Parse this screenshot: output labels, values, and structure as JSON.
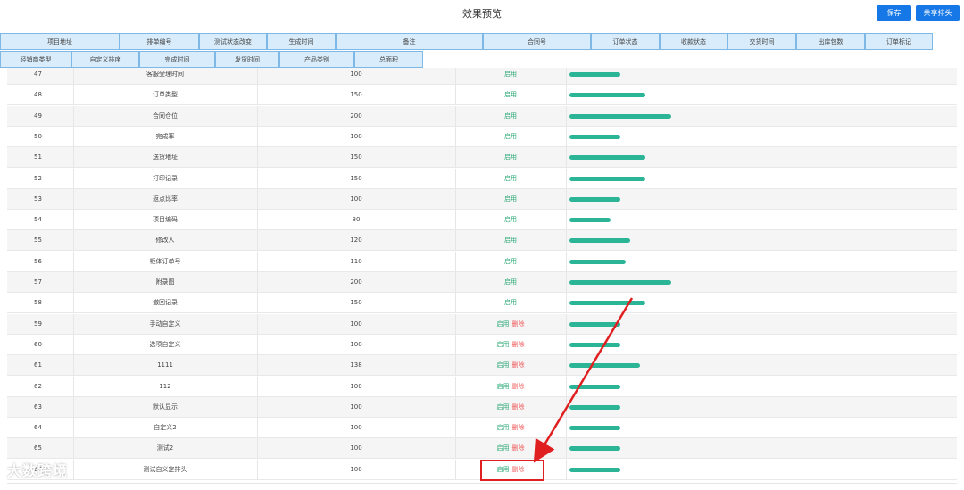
{
  "header": {
    "title": "效果预览",
    "save_label": "保存",
    "share_label": "共享排头"
  },
  "chips_row1": [
    "项目地址",
    "排单编号",
    "测试状态改变",
    "生成时间",
    "备注",
    "合同号",
    "订单状态",
    "收款状态",
    "交货时间",
    "出库包数",
    "订单标记"
  ],
  "chips_row2": [
    "经销商类型",
    "自定义排序",
    "完成时间",
    "发货时间",
    "产品类别",
    "总面积"
  ],
  "actions": {
    "enable": "启用",
    "delete": "删除"
  },
  "rows": [
    {
      "num": "47",
      "name": "客服受理时间",
      "width": "100",
      "deletable": false,
      "bar": 100
    },
    {
      "num": "48",
      "name": "订单类型",
      "width": "150",
      "deletable": false,
      "bar": 150
    },
    {
      "num": "49",
      "name": "合同仓位",
      "width": "200",
      "deletable": false,
      "bar": 200
    },
    {
      "num": "50",
      "name": "完成率",
      "width": "100",
      "deletable": false,
      "bar": 100
    },
    {
      "num": "51",
      "name": "送货地址",
      "width": "150",
      "deletable": false,
      "bar": 150
    },
    {
      "num": "52",
      "name": "打印记录",
      "width": "150",
      "deletable": false,
      "bar": 150
    },
    {
      "num": "53",
      "name": "返点比率",
      "width": "100",
      "deletable": false,
      "bar": 100
    },
    {
      "num": "54",
      "name": "项目编码",
      "width": "80",
      "deletable": false,
      "bar": 80
    },
    {
      "num": "55",
      "name": "修改人",
      "width": "120",
      "deletable": false,
      "bar": 120
    },
    {
      "num": "56",
      "name": "柜体订单号",
      "width": "110",
      "deletable": false,
      "bar": 110
    },
    {
      "num": "57",
      "name": "附录图",
      "width": "200",
      "deletable": false,
      "bar": 200
    },
    {
      "num": "58",
      "name": "撤回记录",
      "width": "150",
      "deletable": false,
      "bar": 150
    },
    {
      "num": "59",
      "name": "手动自定义",
      "width": "100",
      "deletable": true,
      "bar": 100
    },
    {
      "num": "60",
      "name": "选项自定义",
      "width": "100",
      "deletable": true,
      "bar": 100
    },
    {
      "num": "61",
      "name": "1111",
      "width": "138",
      "deletable": true,
      "bar": 138
    },
    {
      "num": "62",
      "name": "112",
      "width": "100",
      "deletable": true,
      "bar": 100
    },
    {
      "num": "63",
      "name": "默认显示",
      "width": "100",
      "deletable": true,
      "bar": 100
    },
    {
      "num": "64",
      "name": "自定义2",
      "width": "100",
      "deletable": true,
      "bar": 100
    },
    {
      "num": "65",
      "name": "测试2",
      "width": "100",
      "deletable": true,
      "bar": 100
    },
    {
      "num": "66",
      "name": "测试自义定排头",
      "width": "100",
      "deletable": true,
      "bar": 100
    }
  ],
  "watermark": "大数跨境",
  "colors": {
    "accent": "#1677e6",
    "chip_bg": "#d8ecfb",
    "chip_border": "#7db8e6",
    "bar": "#2bb596",
    "enable": "#2aa876",
    "delete": "#ef5b5b",
    "highlight": "#e02020"
  }
}
